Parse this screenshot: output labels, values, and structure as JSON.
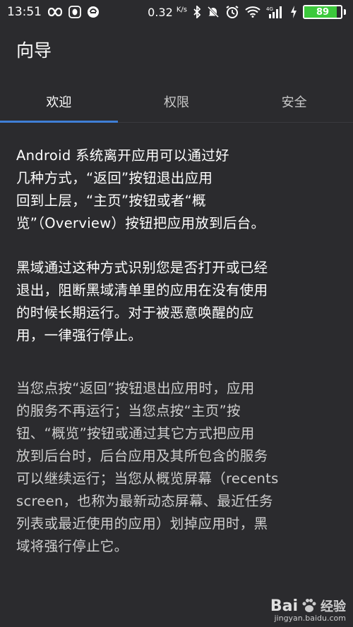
{
  "status_bar": {
    "time": "13:51",
    "speed": "0.32",
    "speed_unit": "K/s",
    "network": "4G",
    "battery": "89",
    "battery_level": 0.89,
    "battery_color": "#3cc93c"
  },
  "header": {
    "title": "向导"
  },
  "tabs": [
    {
      "label": "欢迎",
      "active": true
    },
    {
      "label": "权限",
      "active": false
    },
    {
      "label": "安全",
      "active": false
    }
  ],
  "accent_color": "#3f7fd6",
  "content": {
    "p1_lines": [
      "Android 系统离开应用可以通过好",
      "几种方式，“返回”按钮退出应用",
      "回到上层，“主页”按钮或者“概",
      "览”（Overview）按钮把应用放到后台。"
    ],
    "p2_lines": [
      "黑域通过这种方式识别您是否打开或已经",
      "退出，阻断黑域清单里的应用在没有使用",
      "的时候长期运行。对于被恶意唤醒的应",
      "用，一律强行停止。"
    ],
    "p3_lines": [
      "当您点按“返回”按钮退出应用时，应用",
      "的服务不再运行；当您点按“主页”按",
      "钮、“概览”按钮或通过其它方式把应用",
      "放到后台时，后台应用及其所包含的服务",
      "可以继续运行；当您从概览屏幕（recents",
      "screen，也称为最新动态屏幕、最近任务",
      "列表或最近使用的应用）划掉应用时，黑",
      "域将强行停止它。"
    ]
  },
  "watermark": {
    "brand": "Bai",
    "brand_cn": "经验",
    "url": "jingyan.baidu.com"
  }
}
